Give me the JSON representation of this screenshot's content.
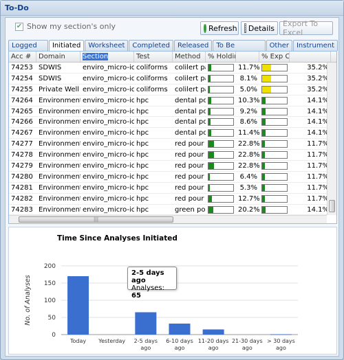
{
  "window": {
    "title": "To-Do"
  },
  "toolbar": {
    "show_my_section_label": "Show my section's only",
    "show_my_section_checked": true,
    "refresh_label": "Refresh",
    "details_label": "Details",
    "export_label": "Export To Excel"
  },
  "tabs": [
    {
      "label": "Logged In",
      "active": false
    },
    {
      "label": "Initiated",
      "active": true
    },
    {
      "label": "Worksheet",
      "active": false
    },
    {
      "label": "Completed",
      "active": false
    },
    {
      "label": "Released",
      "active": false
    },
    {
      "label": "To Be Verified",
      "active": false
    },
    {
      "label": "Other",
      "active": false
    },
    {
      "label": "Instrument",
      "active": false
    }
  ],
  "grid": {
    "columns": [
      "Acc #",
      "Domain",
      "Section",
      "Test",
      "Method",
      "% Holding Used",
      "",
      "% Exp Completion",
      ""
    ],
    "selected_column": 2,
    "rows": [
      {
        "acc": "74253",
        "domain": "SDWIS",
        "section": "enviro_micro-ic",
        "test": "coliforms",
        "method": "colilert pa",
        "holding": "11.7%",
        "holding_frac": 0.117,
        "exp": "35.2%",
        "exp_frac": 0.352,
        "exp_color": "#f0e000"
      },
      {
        "acc": "74254",
        "domain": "SDWIS",
        "section": "enviro_micro-ic",
        "test": "coliforms",
        "method": "colilert pa",
        "holding": "8.1%",
        "holding_frac": 0.081,
        "exp": "35.2%",
        "exp_frac": 0.352,
        "exp_color": "#f0e000"
      },
      {
        "acc": "74255",
        "domain": "Private Well",
        "section": "enviro_micro-ic",
        "test": "coliforms",
        "method": "colilert pa",
        "holding": "5.0%",
        "holding_frac": 0.05,
        "exp": "35.2%",
        "exp_frac": 0.352,
        "exp_color": "#f0e000"
      },
      {
        "acc": "74264",
        "domain": "Environmental",
        "section": "enviro_micro-ic",
        "test": "hpc",
        "method": "dental pou",
        "holding": "10.3%",
        "holding_frac": 0.103,
        "exp": "14.1%",
        "exp_frac": 0.141,
        "exp_color": "#1a8a1a"
      },
      {
        "acc": "74265",
        "domain": "Environmental",
        "section": "enviro_micro-ic",
        "test": "hpc",
        "method": "dental pou",
        "holding": "9.2%",
        "holding_frac": 0.092,
        "exp": "14.1%",
        "exp_frac": 0.141,
        "exp_color": "#1a8a1a"
      },
      {
        "acc": "74266",
        "domain": "Environmental",
        "section": "enviro_micro-ic",
        "test": "hpc",
        "method": "dental pou",
        "holding": "8.6%",
        "holding_frac": 0.086,
        "exp": "14.1%",
        "exp_frac": 0.141,
        "exp_color": "#1a8a1a"
      },
      {
        "acc": "74267",
        "domain": "Environmental",
        "section": "enviro_micro-ic",
        "test": "hpc",
        "method": "dental pou",
        "holding": "11.4%",
        "holding_frac": 0.114,
        "exp": "14.1%",
        "exp_frac": 0.141,
        "exp_color": "#1a8a1a"
      },
      {
        "acc": "74277",
        "domain": "Environmental",
        "section": "enviro_micro-ic",
        "test": "hpc",
        "method": "red pour p",
        "holding": "22.8%",
        "holding_frac": 0.228,
        "exp": "11.7%",
        "exp_frac": 0.117,
        "exp_color": "#1a8a1a"
      },
      {
        "acc": "74278",
        "domain": "Environmental",
        "section": "enviro_micro-ic",
        "test": "hpc",
        "method": "red pour p",
        "holding": "22.8%",
        "holding_frac": 0.228,
        "exp": "11.7%",
        "exp_frac": 0.117,
        "exp_color": "#1a8a1a"
      },
      {
        "acc": "74279",
        "domain": "Environmental",
        "section": "enviro_micro-ic",
        "test": "hpc",
        "method": "red pour p",
        "holding": "22.8%",
        "holding_frac": 0.228,
        "exp": "11.7%",
        "exp_frac": 0.117,
        "exp_color": "#1a8a1a"
      },
      {
        "acc": "74280",
        "domain": "Environmental",
        "section": "enviro_micro-ic",
        "test": "hpc",
        "method": "red pour p",
        "holding": "6.4%",
        "holding_frac": 0.064,
        "exp": "11.7%",
        "exp_frac": 0.117,
        "exp_color": "#1a8a1a"
      },
      {
        "acc": "74281",
        "domain": "Environmental",
        "section": "enviro_micro-ic",
        "test": "hpc",
        "method": "red pour p",
        "holding": "5.3%",
        "holding_frac": 0.053,
        "exp": "11.7%",
        "exp_frac": 0.117,
        "exp_color": "#1a8a1a"
      },
      {
        "acc": "74282",
        "domain": "Environmental",
        "section": "enviro_micro-ic",
        "test": "hpc",
        "method": "red pour p",
        "holding": "12.7%",
        "holding_frac": 0.127,
        "exp": "11.7%",
        "exp_frac": 0.117,
        "exp_color": "#1a8a1a"
      },
      {
        "acc": "74283",
        "domain": "Environmental",
        "section": "enviro_micro-ic",
        "test": "hpc",
        "method": "green pou",
        "holding": "20.2%",
        "holding_frac": 0.202,
        "exp": "14.1%",
        "exp_frac": 0.141,
        "exp_color": "#1a8a1a"
      }
    ],
    "holding_bar_color": "#1a8a1a"
  },
  "tooltip": {
    "title": "2-5 days ago",
    "label": "Analyses:",
    "value": "65"
  },
  "chart_data": {
    "type": "bar",
    "title": "Time Since Analyses Initiated",
    "ylabel": "No. of Analyses",
    "xlabel": "",
    "categories": [
      "Today",
      "Yesterday",
      "2-5 days ago",
      "6-10 days ago",
      "11-20 days ago",
      "21-30 days ago",
      "> 30 days ago"
    ],
    "values": [
      170,
      0,
      65,
      32,
      15,
      0,
      1
    ],
    "ylim": [
      0,
      200
    ],
    "yticks": [
      0,
      50,
      100,
      150,
      200
    ],
    "bar_color": "#3a6fcf",
    "grid": true,
    "legend": false
  }
}
